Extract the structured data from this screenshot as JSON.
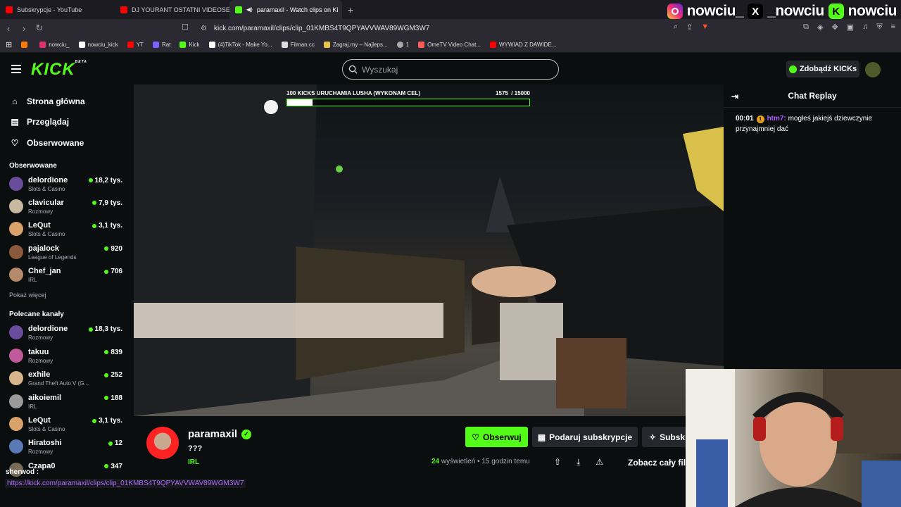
{
  "browser": {
    "tabs": [
      {
        "label": "Subskrypcje - YouTube",
        "color": "#ff0000"
      },
      {
        "label": "DJ YOURANT OSTATNI VIDEOSET",
        "color": "#ff0000"
      },
      {
        "label": "paramaxil - Watch clips on Ki",
        "color": "#53fc18",
        "active": true
      }
    ],
    "url": "kick.com/paramaxil/clips/clip_01KMBS4T9QPYAVVWAV89WGM3W7",
    "bookmarks": [
      {
        "label": "",
        "color": "#ff7a00"
      },
      {
        "label": "nowciu_",
        "color": "#e1306c"
      },
      {
        "label": "nowciu_kick",
        "color": "#ffffff"
      },
      {
        "label": "YT",
        "color": "#ff0000"
      },
      {
        "label": "Rat",
        "color": "#7b61ff"
      },
      {
        "label": "Kick",
        "color": "#53fc18"
      },
      {
        "label": "(4)TikTok - Make Yo...",
        "color": "#ffffff"
      },
      {
        "label": "Filman.cc",
        "color": "#dddddd"
      },
      {
        "label": "Zagraj.my – Najleps...",
        "color": "#e8c34b"
      },
      {
        "label": "1",
        "color": "#aaaaaa"
      },
      {
        "label": "OmeTV Video Chat...",
        "color": "#ff5a5a"
      },
      {
        "label": "WYWIAD Z DAWIDE...",
        "color": "#ff0000"
      }
    ]
  },
  "overlay": {
    "handle1": "nowciu_",
    "handle2": "_nowciu",
    "handle3": "nowciu",
    "x_glyph": "X",
    "k_glyph": "K"
  },
  "header": {
    "logo": "KICK",
    "logo_badge": "BETA",
    "search_placeholder": "Wyszukaj",
    "kicks_button": "Zdobądź KICKs"
  },
  "sidebar": {
    "nav": [
      {
        "icon": "⌂",
        "label": "Strona główna"
      },
      {
        "icon": "▤",
        "label": "Przeglądaj"
      },
      {
        "icon": "♡",
        "label": "Obserwowane"
      }
    ],
    "followed_title": "Obserwowane",
    "followed": [
      {
        "name": "delordione",
        "category": "Slots & Casino",
        "viewers": "18,2 tys.",
        "color": "#6a4c9c"
      },
      {
        "name": "clavicular",
        "category": "Rozmowy",
        "viewers": "7,9 tys.",
        "color": "#c9b8a0"
      },
      {
        "name": "LeQut",
        "category": "Slots & Casino",
        "viewers": "3,1 tys.",
        "color": "#d9a26b"
      },
      {
        "name": "pajalock",
        "category": "League of Legends",
        "viewers": "920",
        "color": "#8b5a3c"
      },
      {
        "name": "Chef_jan",
        "category": "IRL",
        "viewers": "706",
        "color": "#b58a6a"
      }
    ],
    "show_more": "Pokaż więcej",
    "recommended_title": "Polecane kanały",
    "recommended": [
      {
        "name": "delordione",
        "category": "Rozmowy",
        "viewers": "18,3 tys.",
        "color": "#6a4c9c"
      },
      {
        "name": "takuu",
        "category": "Rozmowy",
        "viewers": "839",
        "color": "#c05a9a"
      },
      {
        "name": "exhile",
        "category": "Grand Theft Auto V (G...",
        "viewers": "252",
        "color": "#d8b48a"
      },
      {
        "name": "aikoiemil",
        "category": "IRL",
        "viewers": "188",
        "color": "#9a9a9a"
      },
      {
        "name": "LeQut",
        "category": "Slots & Casino",
        "viewers": "3,1 tys.",
        "color": "#d9a26b"
      },
      {
        "name": "Hiratoshi",
        "category": "Rozmowy",
        "viewers": "12",
        "color": "#5a7ab5"
      },
      {
        "name": "Czapa0",
        "category": "",
        "viewers": "347",
        "color": "#7a6a5a"
      }
    ]
  },
  "video": {
    "goal_label": "100 KICKS URUCHAMIA LUSHA (WYKONAM CEL)",
    "goal_current": "1575",
    "goal_total": "/ 15000",
    "goal_fraction": 0.105
  },
  "chat": {
    "title": "Chat Replay",
    "messages": [
      {
        "time": "00:01",
        "badge": "1",
        "user": "htm7:",
        "text": "mogłeś jakiejś dziewczynie przynajmniej dać"
      }
    ]
  },
  "clip": {
    "channel": "paramaxil",
    "title": "???",
    "category": "IRL",
    "follow": "Obserwuj",
    "gift": "Podaruj subskrypcje",
    "subscribe": "Subskr",
    "views_count": "24",
    "views_label": "wyświetleń",
    "time_ago": "• 15 godzin temu",
    "full": "Zobacz cały fil"
  },
  "status": {
    "label": "sherwod :",
    "link": "https://kick.com/paramaxil/clips/clip_01KMBS4T9QPYAVVWAV89WGM3W7"
  }
}
